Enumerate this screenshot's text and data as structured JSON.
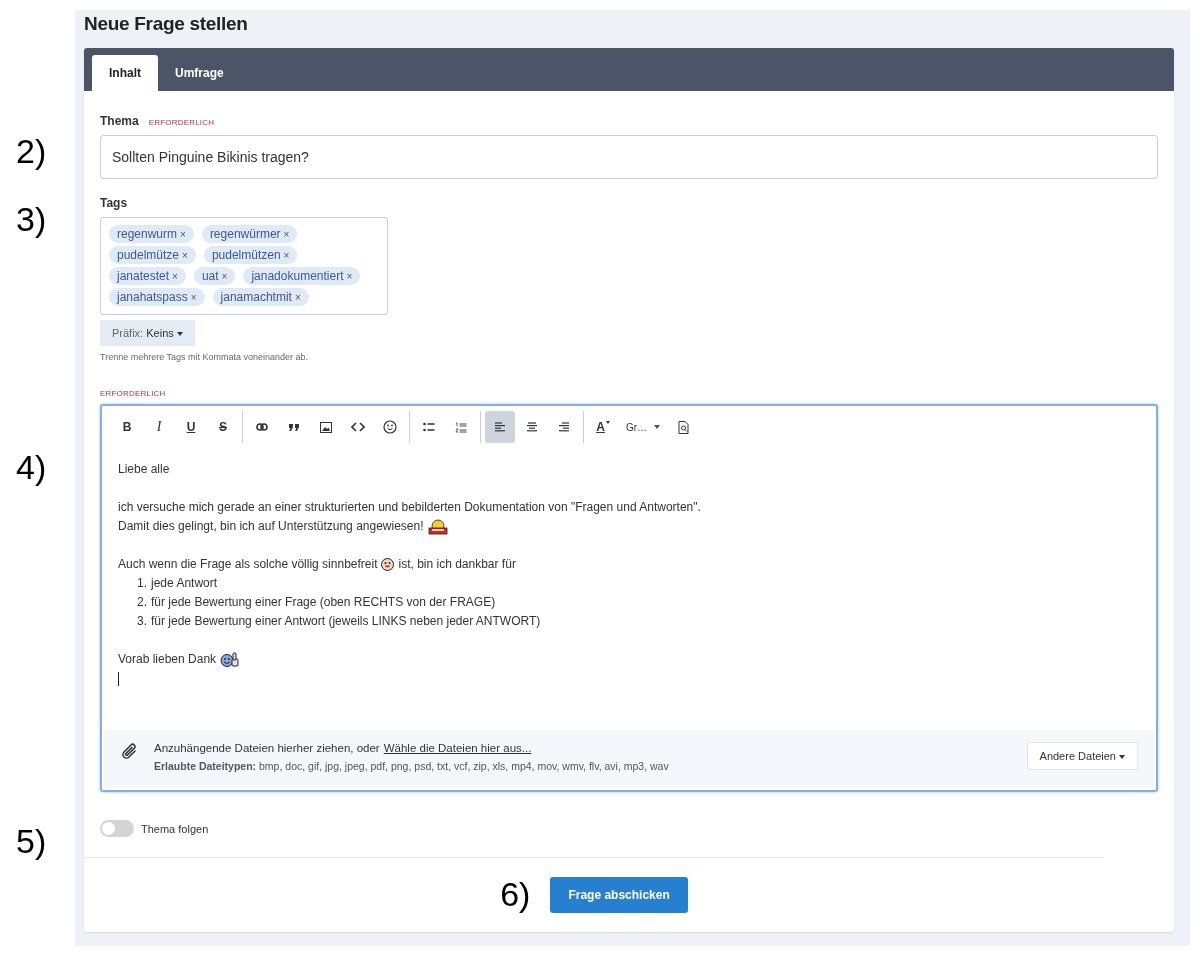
{
  "annotations": [
    {
      "label": "2)",
      "kind": "topic"
    },
    {
      "label": "3)",
      "kind": "tags"
    },
    {
      "label": "4)",
      "kind": "editor"
    },
    {
      "label": "5)",
      "kind": "follow"
    }
  ],
  "page_title": "Neue Frage stellen",
  "tabs": [
    {
      "label": "Inhalt",
      "selected": true
    },
    {
      "label": "Umfrage",
      "selected": false
    }
  ],
  "topic": {
    "label": "Thema",
    "required": "ERFORDERLICH",
    "value": "Sollten Pinguine Bikinis tragen?"
  },
  "tags": {
    "label": "Tags",
    "items": [
      {
        "text": "regenwurm",
        "remove": "×"
      },
      {
        "text": "regenwürmer",
        "remove": "×"
      },
      {
        "text": "pudelmütze",
        "remove": "×"
      },
      {
        "text": "pudelmützen",
        "remove": "×"
      },
      {
        "text": "janatestet",
        "remove": "×"
      },
      {
        "text": "uat",
        "remove": "×"
      },
      {
        "text": "janadokumentiert",
        "remove": "×"
      },
      {
        "text": "janahatspass",
        "remove": "×"
      },
      {
        "text": "janamachtmit",
        "remove": "×"
      }
    ],
    "prefix_label": "Präfix:",
    "prefix_value": "Keins",
    "hint": "Trenne mehrere Tags mit Kommata voneinander ab."
  },
  "editor": {
    "required": "ERFORDERLICH",
    "toolbar": [
      [
        {
          "kind": "bold",
          "label": "B",
          "selected": false
        },
        {
          "kind": "italic",
          "label": "I",
          "selected": false
        },
        {
          "kind": "underline",
          "label": "U",
          "selected": false
        },
        {
          "kind": "strike",
          "label": "S",
          "selected": false
        }
      ],
      [
        {
          "kind": "link",
          "selected": false
        },
        {
          "kind": "quote",
          "selected": false
        },
        {
          "kind": "image",
          "selected": false
        },
        {
          "kind": "code",
          "selected": false
        },
        {
          "kind": "emoji",
          "selected": false
        }
      ],
      [
        {
          "kind": "bullets",
          "selected": false
        },
        {
          "kind": "numbers",
          "selected": false
        }
      ],
      [
        {
          "kind": "align-left",
          "selected": true
        },
        {
          "kind": "align-center",
          "selected": false
        },
        {
          "kind": "align-right",
          "selected": false
        }
      ],
      [
        {
          "kind": "color",
          "label": "A",
          "selected": false
        },
        {
          "kind": "dropdown",
          "label": "Gr…",
          "selected": false
        },
        {
          "kind": "preview",
          "selected": false
        }
      ]
    ],
    "content": [
      {
        "kind": "paragraph",
        "parts": [
          {
            "text": "Liebe alle"
          }
        ]
      },
      {
        "kind": "blank"
      },
      {
        "kind": "paragraph",
        "parts": [
          {
            "text": "ich versuche mich gerade an einer strukturierten und bebilderten Dokumentation von \"Fragen und Antworten\"."
          }
        ]
      },
      {
        "kind": "paragraph",
        "parts": [
          {
            "text": "Damit dies gelingt, bin ich auf Unterstützung angewiesen!"
          },
          {
            "kind": "help-emoji"
          }
        ]
      },
      {
        "kind": "blank"
      },
      {
        "kind": "paragraph",
        "parts": [
          {
            "text": "Auch wenn die Frage als solche völlig sinnbefreit"
          },
          {
            "kind": "grin-emoji"
          },
          {
            "text": "ist, bin ich dankbar für"
          }
        ]
      },
      {
        "kind": "list",
        "items": [
          {
            "number": "1.",
            "text": "jede Antwort"
          },
          {
            "number": "2.",
            "text": "für jede Bewertung einer Frage (oben RECHTS von der FRAGE)"
          },
          {
            "number": "3.",
            "text": "für jede Bewertung einer Antwort (jeweils LINKS neben jeder ANTWORT)"
          }
        ]
      },
      {
        "kind": "blank"
      },
      {
        "kind": "paragraph",
        "parts": [
          {
            "text": "Vorab lieben Dank"
          },
          {
            "kind": "thumbs-emoji"
          }
        ]
      },
      {
        "kind": "cursor"
      }
    ],
    "attach": {
      "text": "Anzuhängende Dateien hierher ziehen, oder",
      "link": "Wähle die Dateien hier aus...",
      "types_label": "Erlaubte Dateitypen:",
      "types": "bmp, doc, gif, jpg, jpeg, pdf, png, psd, txt, vcf, zip, xls, mp4, mov, wmv, flv, avi, mp3, wav",
      "other": "Andere Dateien"
    }
  },
  "follow": {
    "label": "Thema folgen",
    "on": false
  },
  "footer": {
    "annotation": "6)",
    "submit": "Frage abschicken"
  }
}
